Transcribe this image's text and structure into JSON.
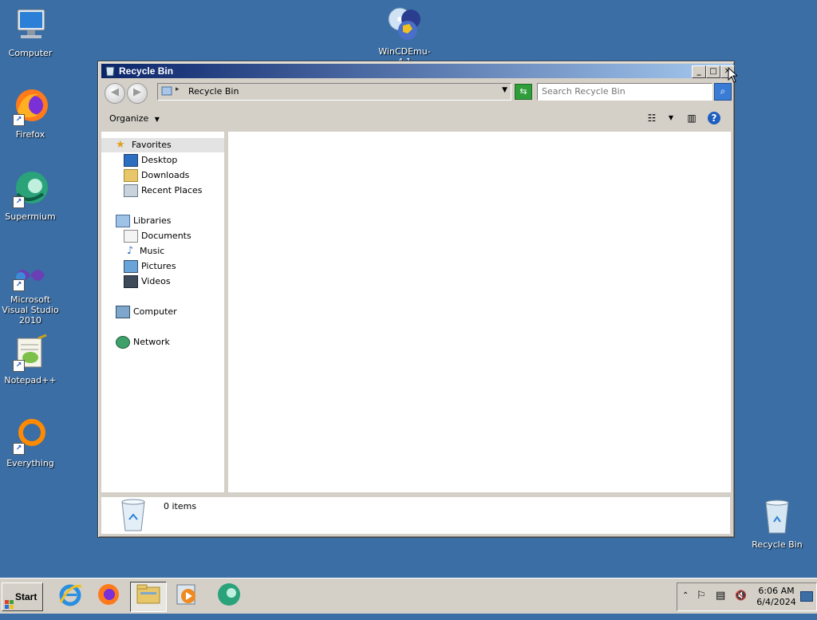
{
  "desktop": {
    "icons": [
      {
        "label": "Computer"
      },
      {
        "label": "Firefox"
      },
      {
        "label": "Supermium"
      },
      {
        "label": "Microsoft Visual Studio 2010"
      },
      {
        "label": "Notepad++"
      },
      {
        "label": "Everything"
      },
      {
        "label": "WinCDEmu-4.1"
      },
      {
        "label": "Recycle Bin"
      }
    ],
    "background_color": "#3a6ea5"
  },
  "window": {
    "title": "Recycle Bin",
    "controls": {
      "minimize": "_",
      "maximize": "□",
      "close": "✕"
    },
    "address": {
      "path": "Recycle Bin"
    },
    "search": {
      "placeholder": "Search Recycle Bin"
    },
    "commandbar": {
      "organize_label": "Organize"
    },
    "navpane": {
      "favorites": {
        "label": "Favorites",
        "items": [
          {
            "label": "Desktop"
          },
          {
            "label": "Downloads"
          },
          {
            "label": "Recent Places"
          }
        ]
      },
      "libraries": {
        "label": "Libraries",
        "items": [
          {
            "label": "Documents"
          },
          {
            "label": "Music"
          },
          {
            "label": "Pictures"
          },
          {
            "label": "Videos"
          }
        ]
      },
      "computer": {
        "label": "Computer"
      },
      "network": {
        "label": "Network"
      }
    },
    "details": {
      "items_text": "0 items"
    }
  },
  "taskbar": {
    "start_label": "Start",
    "apps": [
      "internet-explorer",
      "firefox",
      "file-explorer",
      "media-player",
      "supermium"
    ],
    "clock": {
      "time": "6:06 AM",
      "date": "6/4/2024"
    }
  }
}
